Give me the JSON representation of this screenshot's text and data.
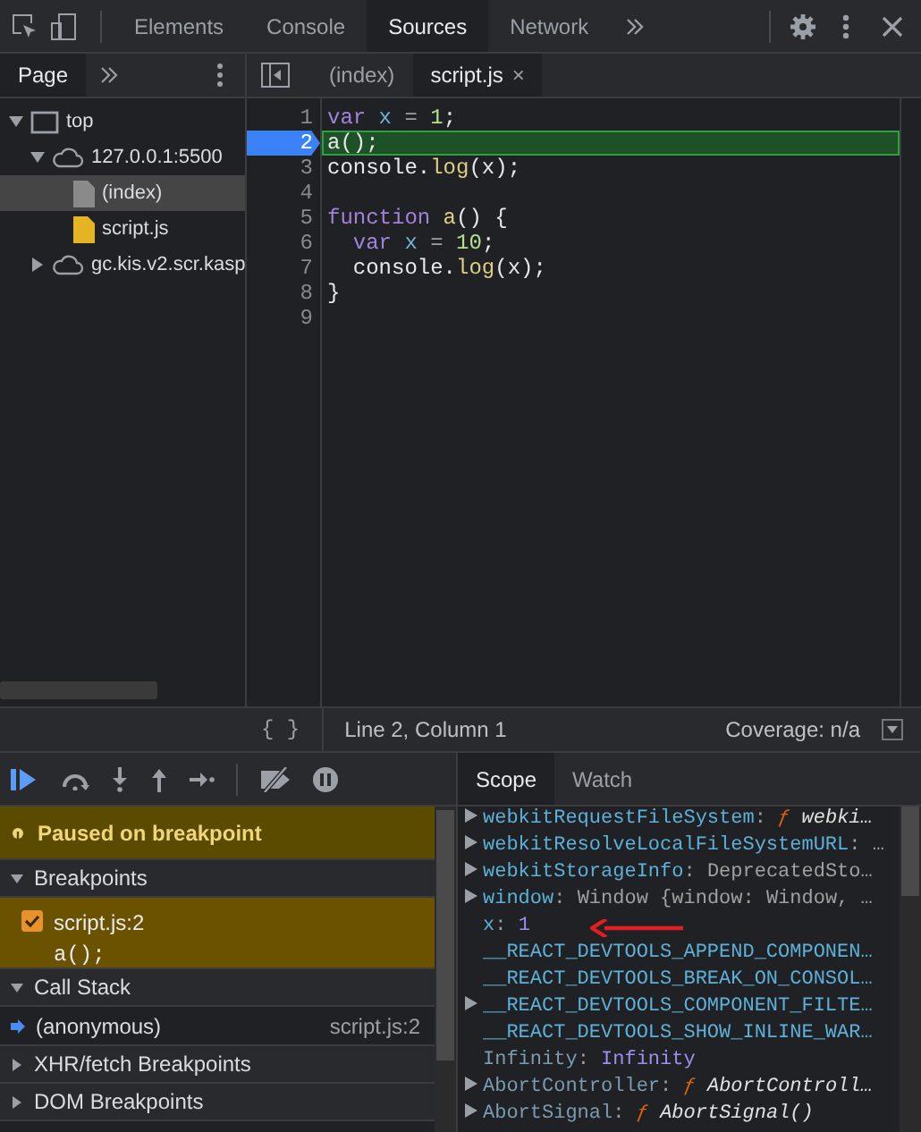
{
  "toolbar": {
    "tabs": [
      {
        "label": "Elements",
        "selected": false
      },
      {
        "label": "Console",
        "selected": false
      },
      {
        "label": "Sources",
        "selected": true
      },
      {
        "label": "Network",
        "selected": false
      }
    ]
  },
  "navigator": {
    "tabs": [
      {
        "label": "Page",
        "selected": true
      }
    ],
    "tree": [
      {
        "label": "top",
        "kind": "frame",
        "expanded": true,
        "selected": false,
        "children": [
          {
            "label": "127.0.0.1:5500",
            "kind": "cloud",
            "expanded": true,
            "selected": false,
            "children": [
              {
                "label": "(index)",
                "kind": "file",
                "selected": true
              },
              {
                "label": "script.js",
                "kind": "script",
                "selected": false
              }
            ]
          },
          {
            "label": "gc.kis.v2.scr.kasp",
            "kind": "cloud",
            "expanded": false,
            "selected": false
          }
        ]
      }
    ]
  },
  "editor": {
    "tabs": [
      {
        "label": "(index)",
        "selected": false
      },
      {
        "label": "script.js",
        "selected": true,
        "close_mark": "×"
      }
    ],
    "lines": [
      {
        "number": "1",
        "breakpoint": false,
        "current": false,
        "tokens": [
          {
            "text": "var",
            "kind": "keyword"
          },
          {
            "text": " x",
            "kind": "variable"
          },
          {
            "text": " =",
            "kind": "operator"
          },
          {
            "text": " 1",
            "kind": "number"
          },
          {
            "text": ";",
            "kind": "plain"
          }
        ]
      },
      {
        "number": "2",
        "breakpoint": true,
        "current": true,
        "tokens": [
          {
            "text": "a();",
            "kind": "plain"
          }
        ]
      },
      {
        "number": "3",
        "breakpoint": false,
        "current": false,
        "tokens": [
          {
            "text": "console.",
            "kind": "plain"
          },
          {
            "text": "log",
            "kind": "property"
          },
          {
            "text": "(x);",
            "kind": "plain"
          }
        ]
      },
      {
        "number": "4",
        "breakpoint": false,
        "current": false
      },
      {
        "number": "5",
        "breakpoint": false,
        "current": false,
        "tokens": [
          {
            "text": "function",
            "kind": "keyword"
          },
          {
            "text": " a",
            "kind": "property"
          },
          {
            "text": "() {",
            "kind": "plain"
          }
        ]
      },
      {
        "number": "6",
        "breakpoint": false,
        "current": false,
        "tokens": [
          {
            "text": "  var",
            "kind": "keyword"
          },
          {
            "text": " x",
            "kind": "variable"
          },
          {
            "text": " =",
            "kind": "operator"
          },
          {
            "text": " 10",
            "kind": "number"
          },
          {
            "text": ";",
            "kind": "plain"
          }
        ]
      },
      {
        "number": "7",
        "breakpoint": false,
        "current": false,
        "tokens": [
          {
            "text": "  console.",
            "kind": "plain"
          },
          {
            "text": "log",
            "kind": "property"
          },
          {
            "text": "(x);",
            "kind": "plain"
          }
        ]
      },
      {
        "number": "8",
        "breakpoint": false,
        "current": false,
        "tokens": [
          {
            "text": "}",
            "kind": "plain"
          }
        ]
      },
      {
        "number": "9",
        "breakpoint": false,
        "current": false
      }
    ],
    "status": {
      "format_button": "{ }",
      "position": "Line 2, Column 1",
      "coverage": "Coverage: n/a"
    }
  },
  "debugger": {
    "paused_message": "Paused on breakpoint",
    "sections": [
      {
        "title": "Breakpoints",
        "kind": "breakpoints",
        "expanded": true,
        "items": [
          {
            "file": "script.js:2",
            "code": "a();",
            "checked": true
          }
        ]
      },
      {
        "title": "Call Stack",
        "kind": "callstack",
        "expanded": true,
        "frames": [
          {
            "name": "(anonymous)",
            "location": "script.js:2",
            "selected": true
          }
        ]
      },
      {
        "title": "XHR/fetch Breakpoints",
        "kind": "plain",
        "expanded": false
      },
      {
        "title": "DOM Breakpoints",
        "kind": "plain",
        "expanded": false
      }
    ]
  },
  "scope": {
    "tabs": [
      {
        "label": "Scope",
        "selected": true
      },
      {
        "label": "Watch",
        "selected": false
      }
    ],
    "items": [
      {
        "name": "webkitRequestFileSystem",
        "separator": ":",
        "expandable": true,
        "dim": false,
        "kind": "function",
        "fn_mark": "ƒ",
        "value": "webki…"
      },
      {
        "name": "webkitResolveLocalFileSystemURL",
        "separator": ":",
        "expandable": true,
        "dim": false,
        "kind": "plain",
        "value": "…"
      },
      {
        "name": "webkitStorageInfo",
        "separator": ":",
        "expandable": true,
        "dim": false,
        "kind": "object",
        "value": "DeprecatedSto…"
      },
      {
        "name": "window",
        "separator": ":",
        "expandable": true,
        "dim": false,
        "kind": "object",
        "value": "Window {window: Window, …"
      },
      {
        "name": "x",
        "separator": ":",
        "expandable": false,
        "dim": false,
        "kind": "number",
        "value": "1",
        "marked": true
      },
      {
        "name": "__REACT_DEVTOOLS_APPEND_COMPONEN…",
        "expandable": false,
        "dim": false
      },
      {
        "name": "__REACT_DEVTOOLS_BREAK_ON_CONSOL…",
        "expandable": false,
        "dim": false
      },
      {
        "name": "__REACT_DEVTOOLS_COMPONENT_FILTE…",
        "expandable": true,
        "dim": false
      },
      {
        "name": "__REACT_DEVTOOLS_SHOW_INLINE_WAR…",
        "expandable": false,
        "dim": false
      },
      {
        "name": "Infinity",
        "separator": ":",
        "expandable": false,
        "dim": true,
        "kind": "number",
        "value": "Infinity"
      },
      {
        "name": "AbortController",
        "separator": ":",
        "expandable": true,
        "dim": true,
        "kind": "function",
        "fn_mark": "ƒ",
        "value": "AbortControll…"
      },
      {
        "name": "AbortSignal",
        "separator": ":",
        "expandable": true,
        "dim": true,
        "kind": "function",
        "fn_mark": "ƒ",
        "value": "AbortSignal()"
      }
    ]
  }
}
